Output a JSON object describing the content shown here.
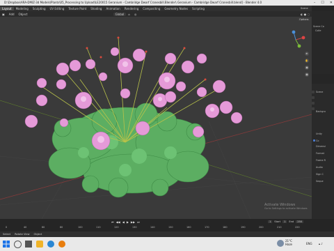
{
  "window": {
    "title": "D:\\Dropbox\\ARA-DMIZ-3d Models\\Plants\\05_Processing to Upload\\LE20015 Geranium - Cambridge Dwarf Cranesbill.Blender\\ Geranium - Cambridge Dwarf Cranesbill.blend] - Blender 4.0",
    "minimize": "–",
    "maximize": "☐",
    "close": "✕"
  },
  "workspaces": [
    "Layout",
    "Modeling",
    "Sculpting",
    "UV Editing",
    "Texture Paint",
    "Shading",
    "Animation",
    "Rendering",
    "Compositing",
    "Geometry Nodes",
    "Scripting"
  ],
  "scene_label": "Scene",
  "header": {
    "add_label": "Add",
    "object_label": "Object",
    "transform_value": "Global",
    "options_label": "Options"
  },
  "outliner": {
    "items": [
      "Scene Co",
      "Colle"
    ]
  },
  "properties": {
    "rows": [
      "Scene",
      "Backgro",
      "Unity",
      "Co",
      "Dimensi",
      "Format",
      "Frame R",
      "Audio",
      "Sign C",
      "Seque"
    ]
  },
  "timeline": {
    "ticks": [
      "0",
      "40",
      "60",
      "80",
      "100",
      "110",
      "120",
      "130",
      "140",
      "150",
      "160",
      "170",
      "180",
      "190",
      "200",
      "210",
      "220"
    ],
    "current_frame": "1",
    "start_label": "Start",
    "start_value": "1",
    "end_label": "End",
    "end_value": "250"
  },
  "status": {
    "select_label": "Select",
    "rotate_label": "Rotate View",
    "object_label": "Object"
  },
  "activation_notice": {
    "line1": "Activate Windows",
    "line2": "Go to Settings to activate Windows"
  },
  "taskbar": {
    "weather_temp": "21°C",
    "weather_desc": "Haze",
    "language": "ENG"
  },
  "colors": {
    "viewport_bg": "#3a3a3a",
    "flower_pink": "#e59ad8",
    "leaf_green": "#5cae62",
    "accent_blue": "#4b7bd0"
  }
}
